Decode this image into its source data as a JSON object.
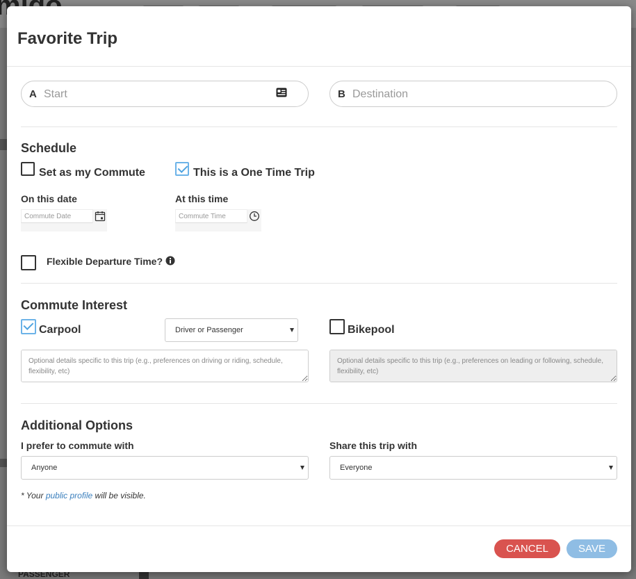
{
  "background": {
    "logo_partial": "migo",
    "bottom_label": "PASSENGER"
  },
  "modal": {
    "title": "Favorite Trip",
    "start": {
      "letter": "A",
      "placeholder": "Start"
    },
    "destination": {
      "letter": "B",
      "placeholder": "Destination"
    },
    "schedule": {
      "title": "Schedule",
      "commute_label": "Set as my Commute",
      "commute_checked": false,
      "one_time_label": "This is a One Time Trip",
      "one_time_checked": true,
      "date_label": "On this date",
      "date_placeholder": "Commute Date",
      "time_label": "At this time",
      "time_placeholder": "Commute Time",
      "flexible_label": "Flexible Departure Time?",
      "flexible_checked": false
    },
    "interest": {
      "title": "Commute Interest",
      "carpool_label": "Carpool",
      "carpool_checked": true,
      "carpool_role": "Driver or Passenger",
      "carpool_details_placeholder": "Optional details specific to this trip (e.g., preferences on driving or riding, schedule, flexibility, etc)",
      "bikepool_label": "Bikepool",
      "bikepool_checked": false,
      "bikepool_details_placeholder": "Optional details specific to this trip (e.g., preferences on leading or following, schedule, flexibility, etc)"
    },
    "options": {
      "title": "Additional Options",
      "prefer_label": "I prefer to commute with",
      "prefer_value": "Anyone",
      "share_label": "Share this trip with",
      "share_value": "Everyone",
      "note_prefix": "* Your ",
      "note_link": "public profile",
      "note_suffix": " will be visible."
    },
    "buttons": {
      "cancel": "CANCEL",
      "save": "SAVE"
    }
  },
  "colors": {
    "cancel": "#d9534f",
    "save": "#8fbde4",
    "check": "#4ea3e0",
    "link": "#3a7fbd"
  }
}
